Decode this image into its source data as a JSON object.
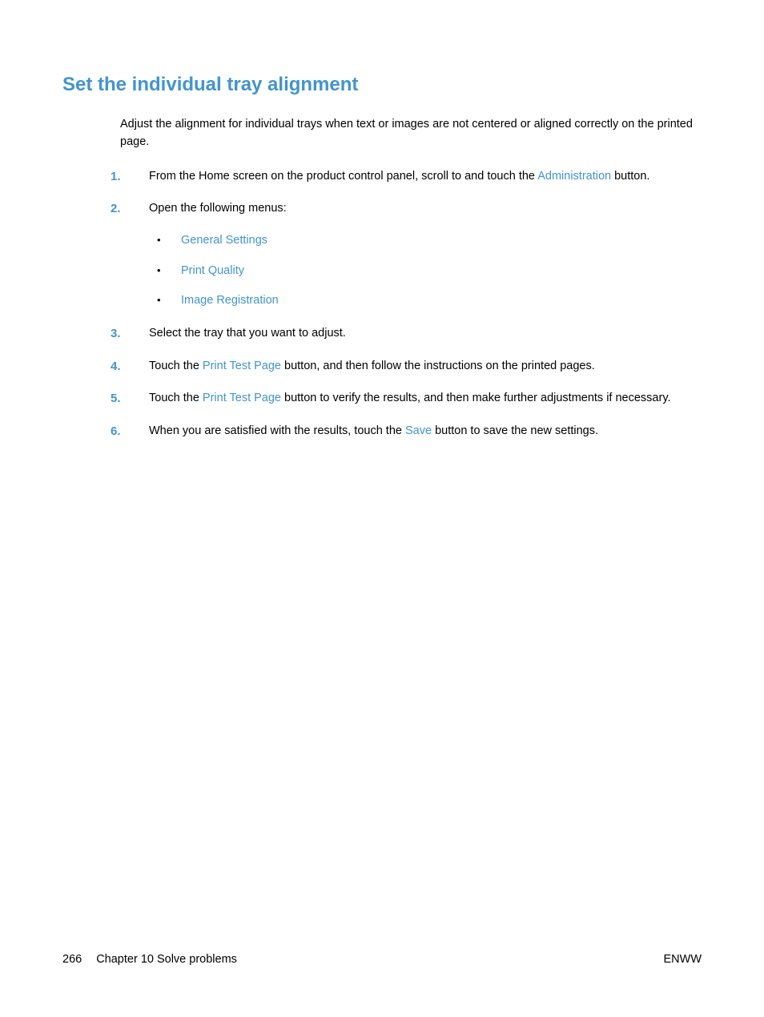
{
  "heading": "Set the individual tray alignment",
  "intro": "Adjust the alignment for individual trays when text or images are not centered or aligned correctly on the printed page.",
  "steps": {
    "s1_pre": "From the Home screen on the product control panel, scroll to and touch the ",
    "s1_link": "Administration",
    "s1_post": " button.",
    "s2": "Open the following menus:",
    "s2_sub": {
      "a": "General Settings",
      "b": "Print Quality",
      "c": "Image Registration"
    },
    "s3": "Select the tray that you want to adjust.",
    "s4_pre": "Touch the ",
    "s4_link": "Print Test Page",
    "s4_post": " button, and then follow the instructions on the printed pages.",
    "s5_pre": "Touch the ",
    "s5_link": "Print Test Page",
    "s5_post": " button to verify the results, and then make further adjustments if necessary.",
    "s6_pre": "When you are satisfied with the results, touch the ",
    "s6_link": "Save",
    "s6_post": " button to save the new settings."
  },
  "footer": {
    "page_number": "266",
    "chapter": "Chapter 10   Solve problems",
    "locale": "ENWW"
  }
}
